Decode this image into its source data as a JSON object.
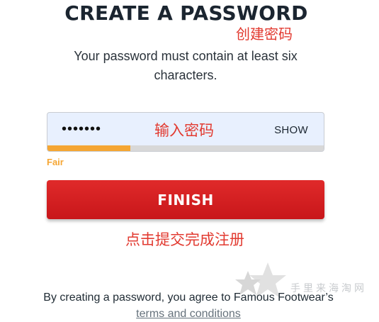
{
  "header": {
    "title": "CREATE A PASSWORD",
    "subtitle": "Your password must contain at least six characters."
  },
  "password_field": {
    "value": "•••••••",
    "toggle_label": "SHOW",
    "strength_label": "Fair",
    "strength_fraction": 0.3
  },
  "finish_button": {
    "label": "FINISH"
  },
  "footer": {
    "text_before_link": "By creating a password, you agree to Famous Footwear’s ",
    "link_text": "terms and conditions"
  },
  "annotations": {
    "title_note": "创建密码",
    "input_note": "输入密码",
    "finish_note": "点击提交完成注册"
  },
  "watermark": {
    "text": "手里来海淘网"
  },
  "colors": {
    "accent_red": "#d41f22",
    "strength_orange": "#f5a633",
    "annotation_red": "#e23a30",
    "input_background": "#e8f0fe"
  }
}
